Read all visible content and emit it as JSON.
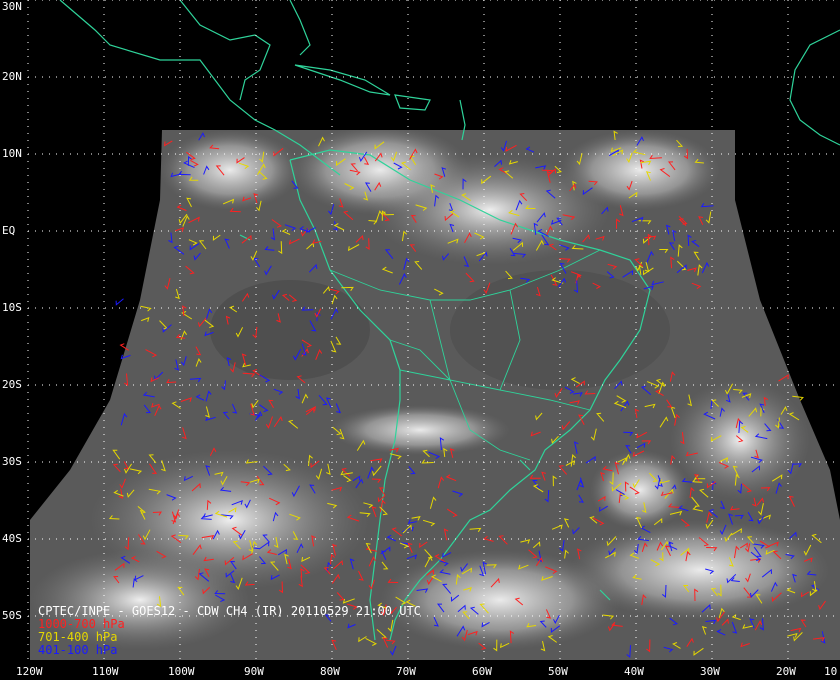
{
  "title": "CPTEC/INPE - GOES12 - CDW CH4 (IR) 20110529 21:00 UTC",
  "legend": [
    {
      "label": "1000-700 hPa",
      "color": "#ff2020"
    },
    {
      "label": "701-400 hPa",
      "color": "#e6d800"
    },
    {
      "label": "401-100 hPa",
      "color": "#1a1aff"
    }
  ],
  "lat_labels": [
    {
      "text": "30N",
      "lat": 30
    },
    {
      "text": "20N",
      "lat": 20
    },
    {
      "text": "10N",
      "lat": 10
    },
    {
      "text": "EQ",
      "lat": 0
    },
    {
      "text": "10S",
      "lat": -10
    },
    {
      "text": "20S",
      "lat": -20
    },
    {
      "text": "30S",
      "lat": -30
    },
    {
      "text": "40S",
      "lat": -40
    },
    {
      "text": "50S",
      "lat": -50
    }
  ],
  "lon_labels": [
    {
      "text": "120W",
      "lon": -120
    },
    {
      "text": "110W",
      "lon": -110
    },
    {
      "text": "100W",
      "lon": -100
    },
    {
      "text": "90W",
      "lon": -90
    },
    {
      "text": "80W",
      "lon": -80
    },
    {
      "text": "70W",
      "lon": -70
    },
    {
      "text": "60W",
      "lon": -60
    },
    {
      "text": "50W",
      "lon": -50
    },
    {
      "text": "40W",
      "lon": -40
    },
    {
      "text": "30W",
      "lon": -30
    },
    {
      "text": "20W",
      "lon": -20
    },
    {
      "text": "10",
      "lon": -10
    }
  ],
  "colors": {
    "coastline": "#2fd39a",
    "grid": "#ffffff",
    "background": "#000000"
  }
}
